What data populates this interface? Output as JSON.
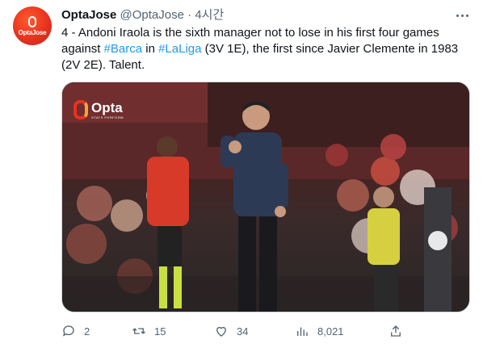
{
  "tweet": {
    "author_name": "OptaJose",
    "author_handle": "@OptaJose",
    "separator": "·",
    "time": "4시간",
    "avatar_text": "OptaJose",
    "text_prefix": "4 - Andoni Iraola is the sixth manager not to lose in his first four games against ",
    "hashtag1": "#Barca",
    "text_mid": " in ",
    "hashtag2": "#LaLiga",
    "text_suffix": " (3V 1E), the first since Javier Clemente in 1983 (2V 2E). Talent.",
    "media_logo": "Opta",
    "media_logo_sub": "STATS PERFORM"
  },
  "actions": {
    "replies": "2",
    "retweets": "15",
    "likes": "34",
    "views": "8,021"
  },
  "colors": {
    "link": "#1d9bf0",
    "text": "#0f1419",
    "muted": "#536471",
    "brand": "#e8321f"
  },
  "icons": [
    "reply-icon",
    "retweet-icon",
    "like-icon",
    "views-icon",
    "share-icon",
    "more-icon"
  ]
}
